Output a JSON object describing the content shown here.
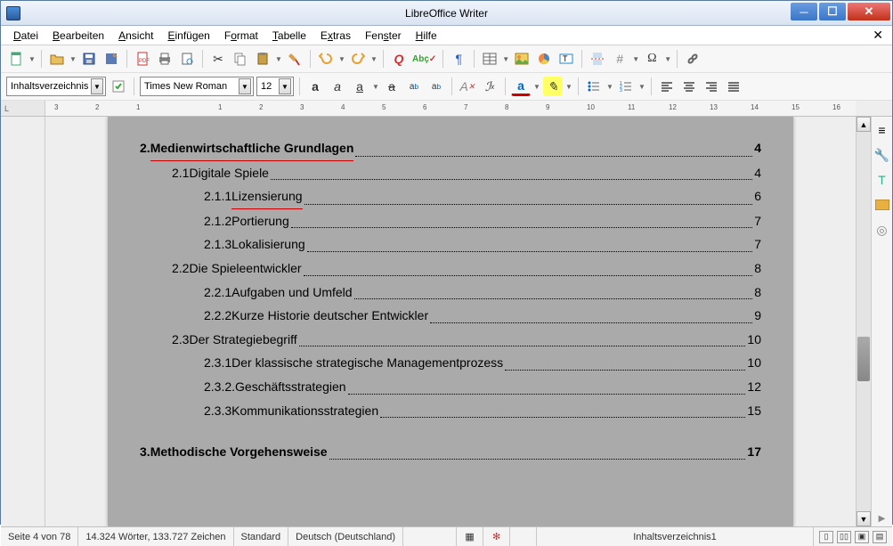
{
  "window": {
    "title": "LibreOffice Writer"
  },
  "menu": {
    "items": [
      "Datei",
      "Bearbeiten",
      "Ansicht",
      "Einfügen",
      "Format",
      "Tabelle",
      "Extras",
      "Fenster",
      "Hilfe"
    ]
  },
  "format_bar": {
    "style": "Inhaltsverzeichnis",
    "font": "Times New Roman",
    "size": "12"
  },
  "ruler": {
    "marks": [
      "3",
      "2",
      "1",
      "",
      "1",
      "2",
      "3",
      "4",
      "5",
      "6",
      "7",
      "8",
      "9",
      "10",
      "11",
      "12",
      "13",
      "14",
      "15",
      "16"
    ]
  },
  "toc": [
    {
      "level": 0,
      "num": "2.",
      "label": "Medienwirtschaftliche Grundlagen",
      "page": "4",
      "squiggle": true
    },
    {
      "level": 1,
      "num": "2.1",
      "label": "Digitale Spiele",
      "page": "4"
    },
    {
      "level": 2,
      "num": "2.1.1",
      "label": "Lizensierung",
      "page": "6",
      "squiggle": true
    },
    {
      "level": 2,
      "num": "2.1.2",
      "label": "Portierung",
      "page": "7"
    },
    {
      "level": 2,
      "num": "2.1.3",
      "label": "Lokalisierung",
      "page": "7"
    },
    {
      "level": 1,
      "num": "2.2",
      "label": "Die Spieleentwickler",
      "page": "8"
    },
    {
      "level": 2,
      "num": "2.2.1",
      "label": "Aufgaben und Umfeld",
      "page": "8"
    },
    {
      "level": 2,
      "num": "2.2.2",
      "label": "Kurze Historie deutscher Entwickler",
      "page": "9"
    },
    {
      "level": 1,
      "num": "2.3",
      "label": "Der Strategiebegriff",
      "page": "10"
    },
    {
      "level": 2,
      "num": "2.3.1",
      "label": "Der klassische strategische Managementprozess",
      "page": "10"
    },
    {
      "level": 2,
      "num": "2.3.2.",
      "label": "Geschäftsstrategien",
      "page": "12"
    },
    {
      "level": 2,
      "num": "2.3.3",
      "label": "Kommunikationsstrategien",
      "page": "15"
    },
    {
      "blank": true
    },
    {
      "level": 0,
      "num": "3.",
      "label": "Methodische Vorgehensweise",
      "page": "17"
    }
  ],
  "status": {
    "page": "Seite 4 von 78",
    "words": "14.324 Wörter, 133.727 Zeichen",
    "mode": "Standard",
    "lang": "Deutsch (Deutschland)",
    "style": "Inhaltsverzeichnis1"
  }
}
